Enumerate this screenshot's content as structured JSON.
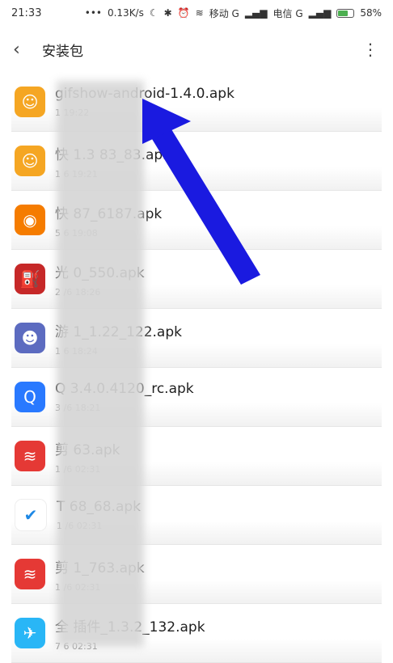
{
  "status_bar": {
    "time": "21:33",
    "dots": "•••",
    "speed": "0.13K/s",
    "carrier1": "移动 G",
    "carrier2": "电信 G",
    "battery": "58%",
    "battery_level": 0.58
  },
  "appbar": {
    "title": "安装包"
  },
  "files": [
    {
      "name": "gifshow-android-1.4.0.apk",
      "meta": "1                19:22",
      "icon": "orange-face-icon",
      "color": "#f5a623"
    },
    {
      "name": "快              1.3   83_83.apk",
      "meta": "1                6 19:21",
      "icon": "orange-face-icon",
      "color": "#f5a623"
    },
    {
      "name": "快              87_6187.apk",
      "meta": "5                6 19:08",
      "icon": "orange-camera-icon",
      "color": "#f57c00"
    },
    {
      "name": "光              0_550.apk",
      "meta": "2                /6 18:26",
      "icon": "gas-pump-icon",
      "color": "#c62828"
    },
    {
      "name": "游              1_1.22_122.apk",
      "meta": "1                6 18:24",
      "icon": "game-character-icon",
      "color": "#5c6bc0"
    },
    {
      "name": "Q              3.4.0.4120_rc.apk",
      "meta": "3                /6 18:21",
      "icon": "q-browser-icon",
      "color": "#2979ff"
    },
    {
      "name": "剪              63.apk",
      "meta": "1                /6 02:31",
      "icon": "red-app-icon",
      "color": "#e53935"
    },
    {
      "name": "T              68_68.apk",
      "meta": "1                /6 02:31",
      "icon": "check-icon",
      "color": "#ffffff"
    },
    {
      "name": "剪              1_763.apk",
      "meta": "1                /6 02:31",
      "icon": "red-app-icon",
      "color": "#e53935"
    },
    {
      "name": "全              插件_1.3.2_132.apk",
      "meta": "7                6 02:31",
      "icon": "plane-icon",
      "color": "#29b6f6"
    }
  ]
}
